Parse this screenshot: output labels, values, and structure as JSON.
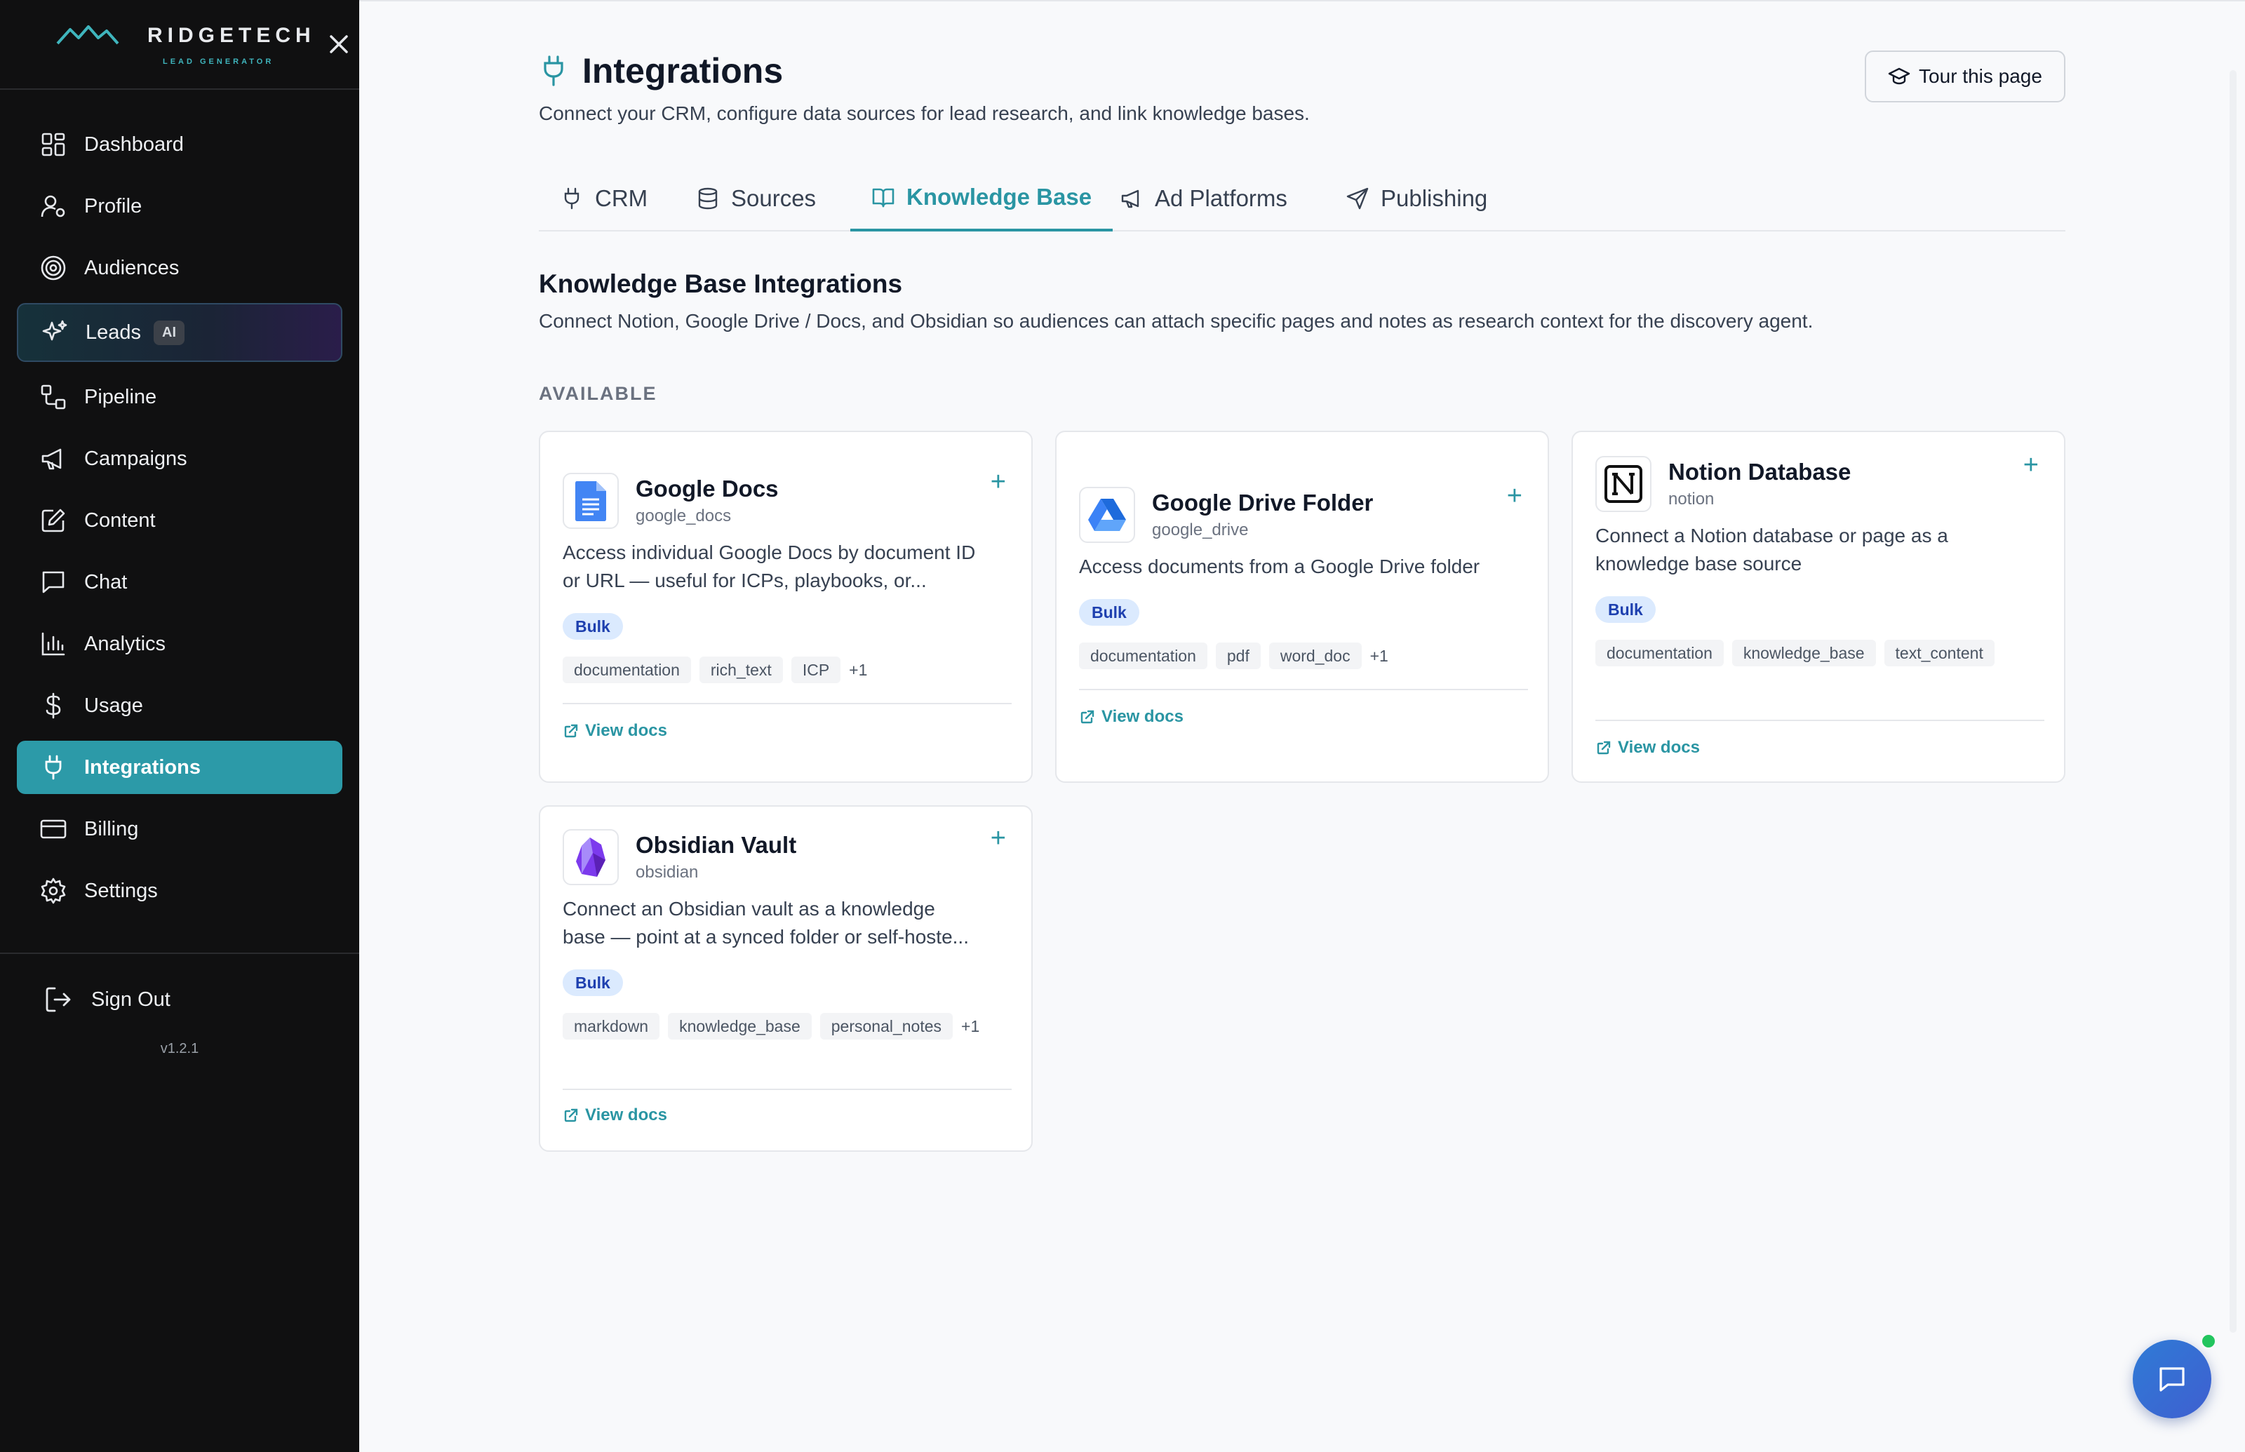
{
  "brand": {
    "name": "RIDGETECH",
    "tagline": "LEAD GENERATOR"
  },
  "sidebar": {
    "items": [
      {
        "label": "Dashboard",
        "icon": "dashboard-icon"
      },
      {
        "label": "Profile",
        "icon": "user-gear-icon"
      },
      {
        "label": "Audiences",
        "icon": "target-icon"
      },
      {
        "label": "Leads",
        "icon": "sparkles-icon",
        "badge": "AI"
      },
      {
        "label": "Pipeline",
        "icon": "pipeline-icon"
      },
      {
        "label": "Campaigns",
        "icon": "megaphone-icon"
      },
      {
        "label": "Content",
        "icon": "edit-icon"
      },
      {
        "label": "Chat",
        "icon": "chat-icon"
      },
      {
        "label": "Analytics",
        "icon": "bar-chart-icon"
      },
      {
        "label": "Usage",
        "icon": "dollar-icon"
      },
      {
        "label": "Integrations",
        "icon": "plug-icon",
        "active": true
      },
      {
        "label": "Billing",
        "icon": "credit-card-icon"
      },
      {
        "label": "Settings",
        "icon": "gear-icon"
      }
    ],
    "signout_label": "Sign Out",
    "version": "v1.2.1"
  },
  "header": {
    "title": "Integrations",
    "subtitle": "Connect your CRM, configure data sources for lead research, and link knowledge bases.",
    "tour_label": "Tour this page"
  },
  "tabs": [
    {
      "label": "CRM",
      "icon": "plug-icon"
    },
    {
      "label": "Sources",
      "icon": "database-icon"
    },
    {
      "label": "Knowledge Base",
      "icon": "book-icon",
      "active": true
    },
    {
      "label": "Ad Platforms",
      "icon": "megaphone-icon"
    },
    {
      "label": "Publishing",
      "icon": "send-icon"
    }
  ],
  "section": {
    "title": "Knowledge Base Integrations",
    "description": "Connect Notion, Google Drive / Docs, and Obsidian so audiences can attach specific pages and notes as research context for the discovery agent.",
    "available_label": "AVAILABLE"
  },
  "cards": [
    {
      "name": "Google Docs",
      "slug": "google_docs",
      "description_line1": "Access individual Google Docs by document ID",
      "description_line2": "or URL — useful for ICPs, playbooks, or...",
      "badge": "Bulk",
      "tags": [
        "documentation",
        "rich_text",
        "ICP"
      ],
      "more": "+1",
      "docs_label": "View docs",
      "logo_icon": "google-docs-icon"
    },
    {
      "name": "Google Drive Folder",
      "slug": "google_drive",
      "description_line1": "Access documents from a Google Drive folder",
      "description_line2": "",
      "badge": "Bulk",
      "tags": [
        "documentation",
        "pdf",
        "word_doc"
      ],
      "more": "+1",
      "docs_label": "View docs",
      "logo_icon": "google-drive-icon"
    },
    {
      "name": "Notion Database",
      "slug": "notion",
      "description_line1": "Connect a Notion database or page as a",
      "description_line2": "knowledge base source",
      "badge": "Bulk",
      "tags": [
        "documentation",
        "knowledge_base",
        "text_content"
      ],
      "more": "",
      "docs_label": "View docs",
      "logo_icon": "notion-icon"
    },
    {
      "name": "Obsidian Vault",
      "slug": "obsidian",
      "description_line1": "Connect an Obsidian vault as a knowledge",
      "description_line2": "base — point at a synced folder or self-hoste...",
      "badge": "Bulk",
      "tags": [
        "markdown",
        "knowledge_base",
        "personal_notes"
      ],
      "more": "+1",
      "docs_label": "View docs",
      "logo_icon": "obsidian-icon"
    }
  ],
  "colors": {
    "accent": "#2a95a3",
    "sidebar_bg": "#101011",
    "badge_bg": "#dbeafe",
    "online": "#22c55e"
  }
}
